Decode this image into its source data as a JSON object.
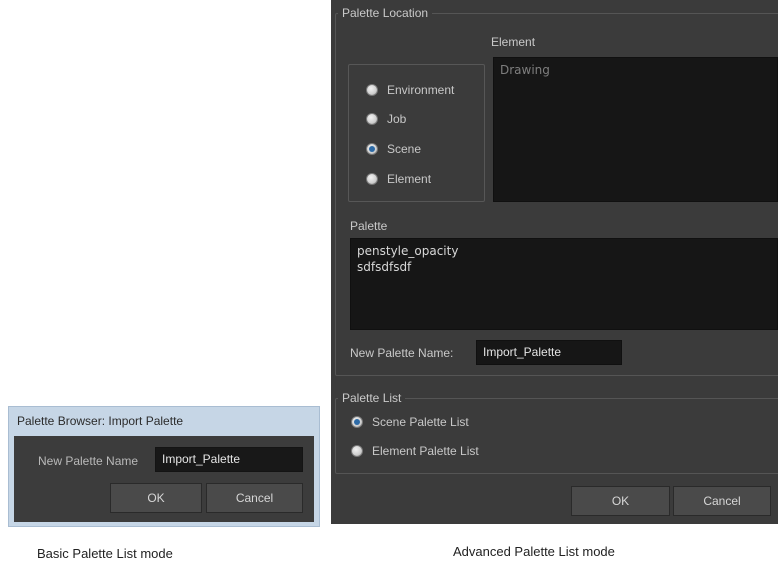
{
  "basic_dialog": {
    "title": "Palette Browser: Import Palette",
    "new_palette_label": "New Palette Name",
    "new_palette_value": "Import_Palette",
    "ok_label": "OK",
    "cancel_label": "Cancel"
  },
  "advanced_dialog": {
    "palette_location": {
      "group_title": "Palette Location",
      "options": [
        {
          "label": "Environment",
          "checked": false
        },
        {
          "label": "Job",
          "checked": false
        },
        {
          "label": "Scene",
          "checked": true
        },
        {
          "label": "Element",
          "checked": false
        }
      ],
      "element_label": "Element",
      "element_items": [
        "Drawing"
      ]
    },
    "palette": {
      "label": "Palette",
      "items": [
        "penstyle_opacity",
        "sdfsdfsdf"
      ]
    },
    "new_palette_label": "New Palette Name:",
    "new_palette_value": "Import_Palette",
    "palette_list": {
      "group_title": "Palette List",
      "options": [
        {
          "label": "Scene Palette List",
          "checked": true
        },
        {
          "label": "Element Palette List",
          "checked": false
        }
      ]
    },
    "ok_label": "OK",
    "cancel_label": "Cancel"
  },
  "captions": {
    "basic": "Basic  Palette List mode",
    "advanced": "Advanced Palette List mode"
  },
  "colors": {
    "dialog_bg": "#3b3b3b",
    "field_bg": "#161616",
    "title_bar": "#c6d6e6",
    "radio_selected": "#2d6aa6"
  }
}
